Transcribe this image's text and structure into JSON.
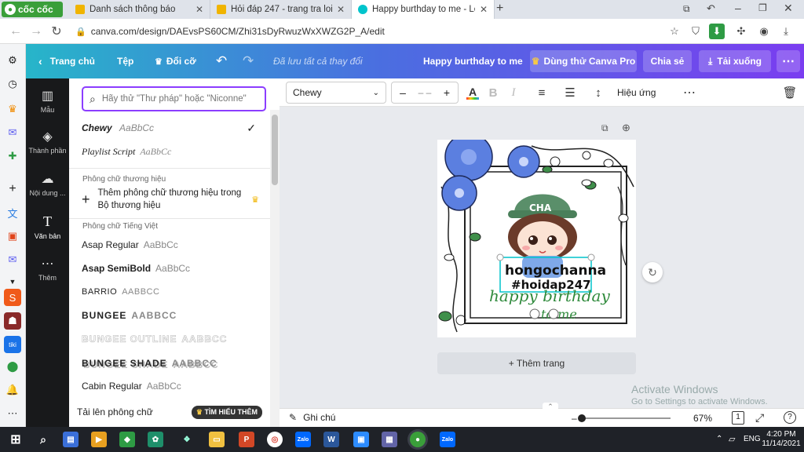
{
  "browser": {
    "brand": "cốc cốc",
    "tabs": [
      {
        "title": "Danh sách thông báo",
        "active": false
      },
      {
        "title": "Hỏi đáp 247 - trang tra loi",
        "active": false
      },
      {
        "title": "Happy burthday to me - Logo",
        "active": true
      }
    ],
    "url": "canva.com/design/DAEvsPS60CM/Zhi31sDyRwuzWxXWZG2P_A/edit"
  },
  "header": {
    "home": "Trang chủ",
    "file": "Tệp",
    "resize": "Đổi cỡ",
    "saved": "Đã lưu tất cả thay đổi",
    "doc_title": "Happy burthday to me",
    "try_pro": "Dùng thử Canva Pro",
    "share": "Chia sẻ",
    "download": "Tải xuống"
  },
  "left_nav": [
    {
      "label": "Mẫu",
      "icon": "template-icon"
    },
    {
      "label": "Thành phần",
      "icon": "elements-icon"
    },
    {
      "label": "Nội dung ...",
      "icon": "upload-icon"
    },
    {
      "label": "Văn bản",
      "icon": "text-icon"
    },
    {
      "label": "Thêm",
      "icon": "more-icon"
    }
  ],
  "panel": {
    "search_placeholder": "Hãy thử \"Thư pháp\" hoặc \"Niconne\"",
    "top_fonts": [
      {
        "name": "Chewy",
        "sample": "AaBbCc",
        "selected": true
      },
      {
        "name": "Playlist Script",
        "sample": "AaBbCc",
        "selected": false
      }
    ],
    "brand_label": "Phông chữ thương hiệu",
    "brand_add": "Thêm phông chữ thương hiệu trong Bộ thương hiệu",
    "viet_label": "Phông chữ Tiếng Việt",
    "viet_fonts": [
      {
        "name": "Asap Regular",
        "sample": "AaBbCc"
      },
      {
        "name": "Asap SemiBold",
        "sample": "AaBbCc"
      },
      {
        "name": "BARRIO",
        "sample": "AABBCC"
      },
      {
        "name": "BUNGEE",
        "sample": "AABBCC"
      },
      {
        "name": "BUNGEE OUTLINE",
        "sample": "AABBCC"
      },
      {
        "name": "BUNGEE SHADE",
        "sample": "AABBCC"
      },
      {
        "name": "Cabin Regular",
        "sample": "AaBbCc"
      }
    ],
    "upload_font": "Tải lên phông chữ",
    "learn_more": "TÌM HIỂU THÊM"
  },
  "toolbar": {
    "font": "Chewy",
    "size": "– –",
    "effects": "Hiệu ứng"
  },
  "design": {
    "hat_text": "CHA",
    "name_text": "hongochanna",
    "tag_text": "#hoidap247",
    "script_text": "happy birthday",
    "script_text2": "to me"
  },
  "add_page": "+ Thêm trang",
  "watermark": {
    "line1": "Activate Windows",
    "line2": "Go to Settings to activate Windows."
  },
  "footer": {
    "notes": "Ghi chú",
    "zoom": "67%",
    "pages": "1"
  },
  "taskbar": {
    "lang": "ENG",
    "time": "4:20 PM",
    "date": "11/14/2021"
  },
  "colors": {
    "accent": "#8b3dff",
    "flower": "#5b7fe0",
    "leaf": "#2f8a3c"
  }
}
